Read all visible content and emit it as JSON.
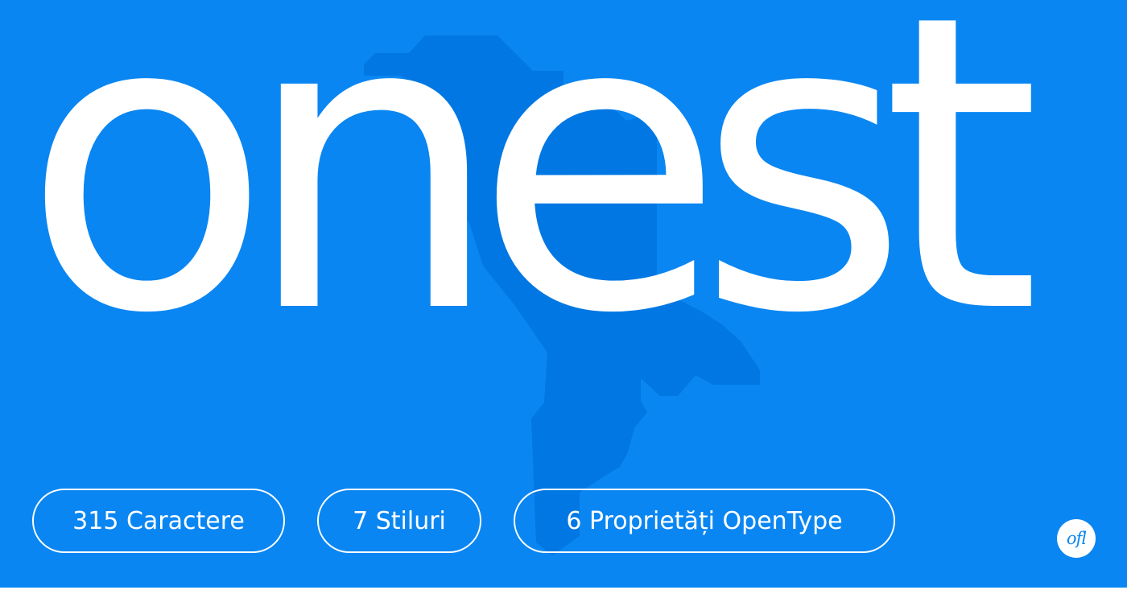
{
  "colors": {
    "background": "#0a86f2",
    "map_shape": "#0077e2",
    "foreground": "#ffffff"
  },
  "wordmark": "onest",
  "features": [
    {
      "label": "315 Caractere"
    },
    {
      "label": "7 Stiluri"
    },
    {
      "label": "6 Proprietăți OpenType"
    }
  ],
  "license_badge": {
    "label": "ofl",
    "icon": "ofl-license-icon"
  }
}
